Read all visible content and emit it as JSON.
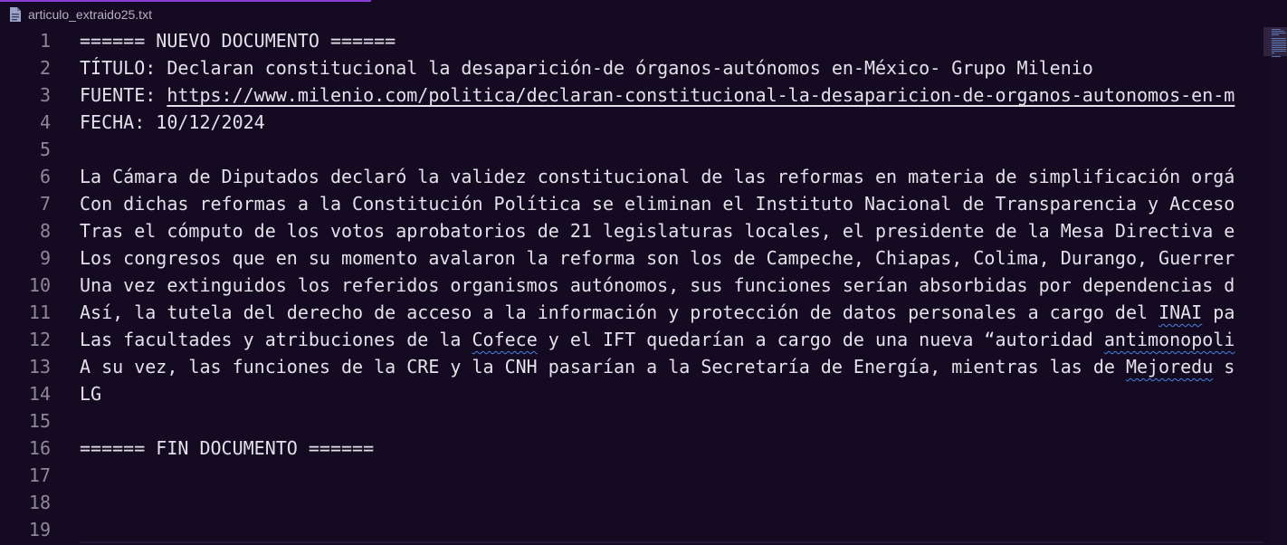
{
  "tab": {
    "filename": "articulo_extraido25.txt",
    "icon": "file-text-icon"
  },
  "colors": {
    "background": "#140a21",
    "text": "#e3e1e9",
    "line_numbers": "#8c8896",
    "tab_accent": "#8a3ad6",
    "spellcheck_squiggle": "#4a82e0"
  },
  "lines": [
    {
      "n": "1",
      "segs": [
        {
          "t": "====== NUEVO DOCUMENTO ======"
        }
      ]
    },
    {
      "n": "2",
      "segs": [
        {
          "t": "TÍTULO: Declaran constitucional la desaparición-de órganos-autónomos en-México- Grupo Milenio"
        }
      ]
    },
    {
      "n": "3",
      "segs": [
        {
          "t": "FUENTE: "
        },
        {
          "t": "https://www.milenio.com/politica/declaran-constitucional-la-desaparicion-de-organos-autonomos-en-m",
          "s": "url"
        }
      ]
    },
    {
      "n": "4",
      "segs": [
        {
          "t": "FECHA: 10/12/2024"
        }
      ]
    },
    {
      "n": "5",
      "segs": []
    },
    {
      "n": "6",
      "segs": [
        {
          "t": "La Cámara de Diputados declaró la validez constitucional de las reformas en materia de simplificación orgá"
        }
      ]
    },
    {
      "n": "7",
      "segs": [
        {
          "t": "Con dichas reformas a la Constitución Política se eliminan el Instituto Nacional de Transparencia y Acceso"
        }
      ]
    },
    {
      "n": "8",
      "segs": [
        {
          "t": "Tras el cómputo de los votos aprobatorios de 21 legislaturas locales, el presidente de la Mesa Directiva e"
        }
      ]
    },
    {
      "n": "9",
      "segs": [
        {
          "t": "Los congresos que en su momento avalaron la reforma son los de Campeche, Chiapas, Colima, Durango, Guerrer"
        }
      ]
    },
    {
      "n": "10",
      "segs": [
        {
          "t": "Una vez extinguidos los referidos organismos autónomos, sus funciones serían absorbidas por dependencias d"
        }
      ]
    },
    {
      "n": "11",
      "segs": [
        {
          "t": "Así, la tutela del derecho de acceso a la información y protección de datos personales a cargo del "
        },
        {
          "t": "INAI",
          "s": "sq"
        },
        {
          "t": " pa"
        }
      ]
    },
    {
      "n": "12",
      "segs": [
        {
          "t": "Las facultades y atribuciones de la "
        },
        {
          "t": "Cofece",
          "s": "sq"
        },
        {
          "t": " y el IFT quedarían a cargo de una nueva “autoridad "
        },
        {
          "t": "antimonopoli",
          "s": "sq"
        }
      ]
    },
    {
      "n": "13",
      "segs": [
        {
          "t": "A su vez, las funciones de la CRE y la CNH pasarían a la Secretaría de Energía, mientras las de "
        },
        {
          "t": "Mejoredu",
          "s": "sq"
        },
        {
          "t": " s"
        }
      ]
    },
    {
      "n": "14",
      "segs": [
        {
          "t": "LG"
        }
      ]
    },
    {
      "n": "15",
      "segs": []
    },
    {
      "n": "16",
      "segs": [
        {
          "t": "====== FIN DOCUMENTO ======"
        }
      ]
    },
    {
      "n": "17",
      "segs": []
    },
    {
      "n": "18",
      "segs": []
    },
    {
      "n": "19",
      "segs": []
    }
  ]
}
